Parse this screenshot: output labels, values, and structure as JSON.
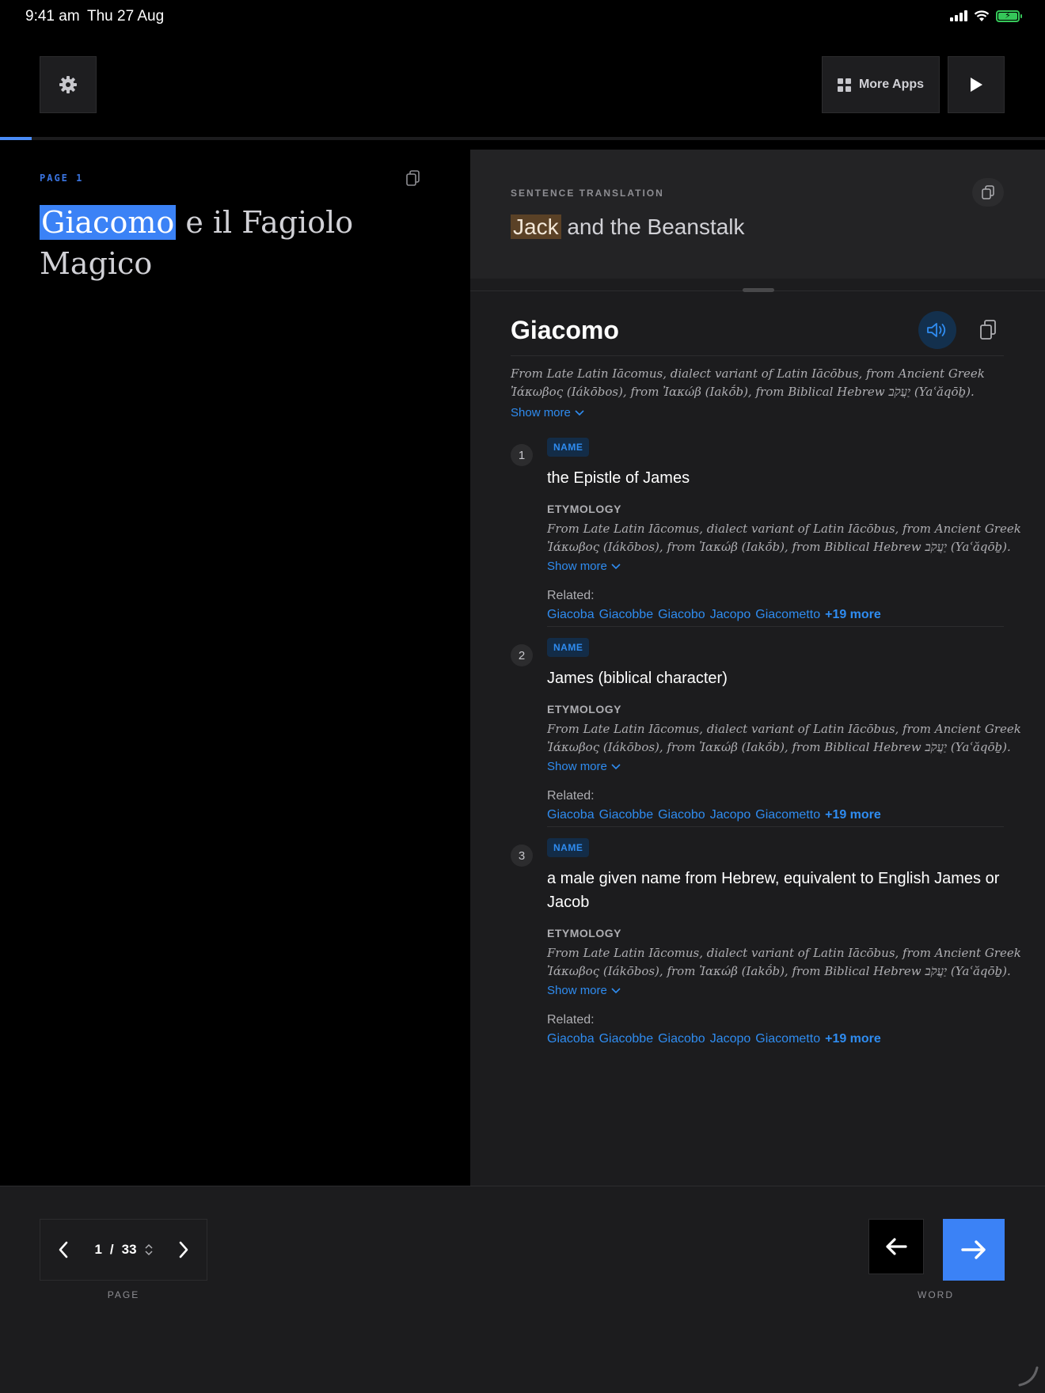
{
  "status_bar": {
    "time": "9:41 am",
    "date": "Thu 27 Aug"
  },
  "toolbar": {
    "more_apps_label": "More Apps"
  },
  "reader": {
    "page_label": "PAGE 1",
    "highlighted_word": "Giacomo",
    "text_line1_rest": " e il Fagiolo",
    "text_line2": "Magico"
  },
  "translation": {
    "label": "SENTENCE TRANSLATION",
    "highlighted_word": "Jack",
    "rest": " and the Beanstalk"
  },
  "entry": {
    "word": "Giacomo",
    "etymology": "From Late Latin Iācomus, dialect variant of Latin Iācōbus, from Ancient Greek Ἰάκωβος (Iákōbos), from Ἰακώβ (Iakṓb), from Biblical Hebrew יַעֲקֹב‎ (Yaʿăqōḇ).",
    "show_more": "Show more",
    "senses": [
      {
        "num": "1",
        "pos": "NAME",
        "gloss": "the Epistle of James",
        "etym_label": "ETYMOLOGY",
        "etym_line1": "From Late Latin Iācomus, dialect variant of Latin Iācōbus, from Ancient Greek",
        "etym_line2": "Ἰάκωβος (Iákōbos), from Ἰακώβ (Iakṓb), from Biblical Hebrew יַעֲקֹב‎ (Yaʿăqōḇ).",
        "show_more": "Show more",
        "related_label": "Related:",
        "related": [
          "Giacoba",
          "Giacobbe",
          "Giacobo",
          "Jacopo",
          "Giacometto"
        ],
        "related_more": "+19 more"
      },
      {
        "num": "2",
        "pos": "NAME",
        "gloss": "James (biblical character)",
        "etym_label": "ETYMOLOGY",
        "etym_line1": "From Late Latin Iācomus, dialect variant of Latin Iācōbus, from Ancient Greek",
        "etym_line2": "Ἰάκωβος (Iákōbos), from Ἰακώβ (Iakṓb), from Biblical Hebrew יַעֲקֹב‎ (Yaʿăqōḇ).",
        "show_more": "Show more",
        "related_label": "Related:",
        "related": [
          "Giacoba",
          "Giacobbe",
          "Giacobo",
          "Jacopo",
          "Giacometto"
        ],
        "related_more": "+19 more"
      },
      {
        "num": "3",
        "pos": "NAME",
        "gloss": "a male given name from Hebrew, equivalent to English James or Jacob",
        "etym_label": "ETYMOLOGY",
        "etym_line1": "From Late Latin Iācomus, dialect variant of Latin Iācōbus, from Ancient Greek",
        "etym_line2": "Ἰάκωβος (Iákōbos), from Ἰακώβ (Iakṓb), from Biblical Hebrew יַעֲקֹב‎ (Yaʿăqōḇ).",
        "show_more": "Show more",
        "related_label": "Related:",
        "related": [
          "Giacoba",
          "Giacobbe",
          "Giacobo",
          "Jacopo",
          "Giacometto"
        ],
        "related_more": "+19 more"
      }
    ]
  },
  "pager": {
    "current": "1",
    "separator": "/",
    "total": "33",
    "caption": "PAGE"
  },
  "word_nav": {
    "caption": "WORD"
  },
  "colors": {
    "accent": "#3b82f6",
    "link": "#2f8cf0",
    "highlight_source": "#3b82f6",
    "highlight_translation": "#5a4126"
  },
  "progress": {
    "fraction": 0.03
  }
}
